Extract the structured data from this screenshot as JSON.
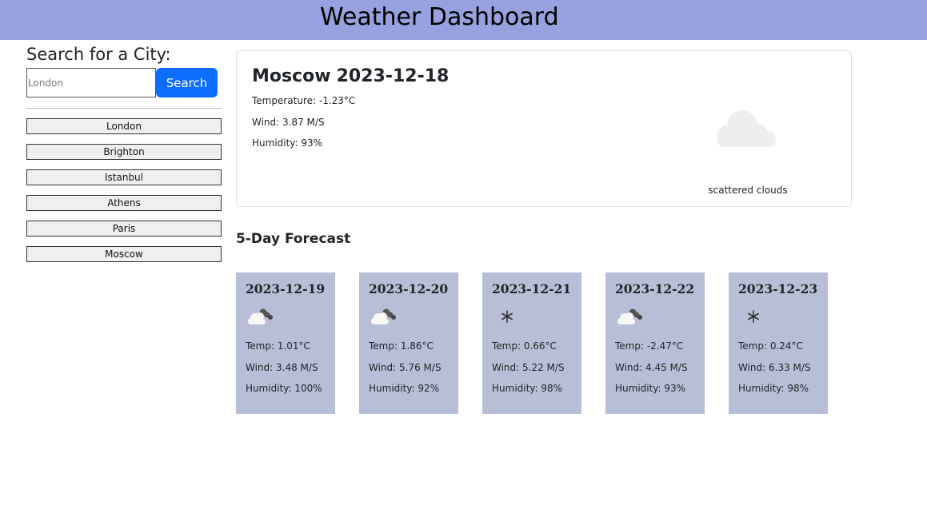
{
  "header": {
    "title": "Weather Dashboard"
  },
  "sidebar": {
    "search_label": "Search for a City:",
    "search_placeholder": "London",
    "search_value": "",
    "search_button": "Search",
    "history": [
      "London",
      "Brighton",
      "Istanbul",
      "Athens",
      "Paris",
      "Moscow"
    ]
  },
  "current": {
    "city": "Moscow",
    "date": "2023-12-18",
    "temperature": "Temperature: -1.23°C",
    "wind": "Wind: 3.87 M/S",
    "humidity": "Humidity: 93%",
    "icon": "scattered-clouds-icon",
    "description": "scattered clouds"
  },
  "forecast": {
    "heading": "5-Day Forecast",
    "days": [
      {
        "date": "2023-12-19",
        "icon": "cloudy-night-icon",
        "temp": "Temp: 1.01°C",
        "wind": "Wind: 3.48 M/S",
        "humidity": "Humidity: 100%"
      },
      {
        "date": "2023-12-20",
        "icon": "cloudy-night-icon",
        "temp": "Temp: 1.86°C",
        "wind": "Wind: 5.76 M/S",
        "humidity": "Humidity: 92%"
      },
      {
        "date": "2023-12-21",
        "icon": "snow-icon",
        "temp": "Temp: 0.66°C",
        "wind": "Wind: 5.22 M/S",
        "humidity": "Humidity: 98%"
      },
      {
        "date": "2023-12-22",
        "icon": "cloudy-night-icon",
        "temp": "Temp: -2.47°C",
        "wind": "Wind: 4.45 M/S",
        "humidity": "Humidity: 93%"
      },
      {
        "date": "2023-12-23",
        "icon": "snow-icon",
        "temp": "Temp: 0.24°C",
        "wind": "Wind: 6.33 M/S",
        "humidity": "Humidity: 98%"
      }
    ]
  },
  "colors": {
    "header_bg": "#96a2df",
    "search_button_bg": "#0d6efd",
    "forecast_card_bg": "#b8bed6"
  }
}
